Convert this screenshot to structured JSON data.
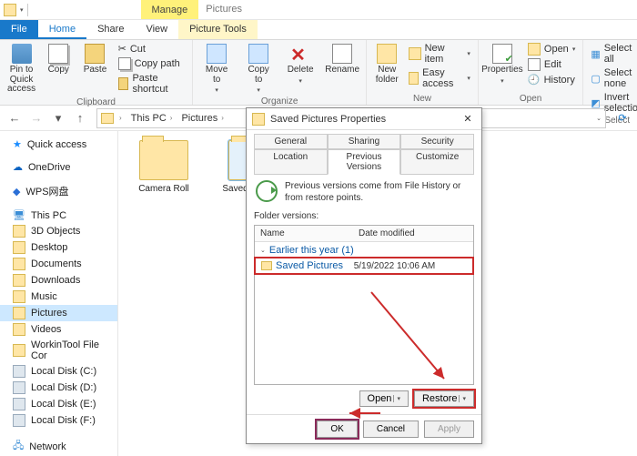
{
  "window": {
    "title": "Pictures"
  },
  "tabs": {
    "file": "File",
    "home": "Home",
    "share": "Share",
    "view": "View",
    "manage": "Manage",
    "picture_tools": "Picture Tools"
  },
  "ribbon": {
    "clipboard": {
      "label": "Clipboard",
      "pin": "Pin to Quick\naccess",
      "copy": "Copy",
      "paste": "Paste",
      "cut": "Cut",
      "copy_path": "Copy path",
      "paste_shortcut": "Paste shortcut"
    },
    "organize": {
      "label": "Organize",
      "move": "Move\nto",
      "copy_to": "Copy\nto",
      "delete": "Delete",
      "rename": "Rename"
    },
    "new": {
      "label": "New",
      "new_folder": "New\nfolder",
      "new_item": "New item",
      "easy_access": "Easy access"
    },
    "open": {
      "label": "Open",
      "properties": "Properties",
      "open": "Open",
      "edit": "Edit",
      "history": "History"
    },
    "select": {
      "label": "Select",
      "select_all": "Select all",
      "select_none": "Select none",
      "invert": "Invert selection"
    }
  },
  "breadcrumbs": {
    "this_pc": "This PC",
    "pictures": "Pictures"
  },
  "sidebar": {
    "quick_access": "Quick access",
    "onedrive": "OneDrive",
    "wps": "WPS网盘",
    "this_pc": "This PC",
    "items": [
      "3D Objects",
      "Desktop",
      "Documents",
      "Downloads",
      "Music",
      "Pictures",
      "Videos",
      "WorkinTool File Cor",
      "Local Disk (C:)",
      "Local Disk (D:)",
      "Local Disk (E:)",
      "Local Disk (F:)"
    ],
    "network": "Network"
  },
  "content": {
    "folder1": "Camera Roll",
    "folder2": "Saved Pictures"
  },
  "dialog": {
    "title": "Saved Pictures Properties",
    "tabs": {
      "general": "General",
      "sharing": "Sharing",
      "security": "Security",
      "location": "Location",
      "prev": "Previous Versions",
      "customize": "Customize"
    },
    "info": "Previous versions come from File History or from restore points.",
    "fv_label": "Folder versions:",
    "col_name": "Name",
    "col_date": "Date modified",
    "group": "Earlier this year (1)",
    "row_name": "Saved Pictures",
    "row_date": "5/19/2022 10:06 AM",
    "open": "Open",
    "restore": "Restore",
    "ok": "OK",
    "cancel": "Cancel",
    "apply": "Apply"
  }
}
